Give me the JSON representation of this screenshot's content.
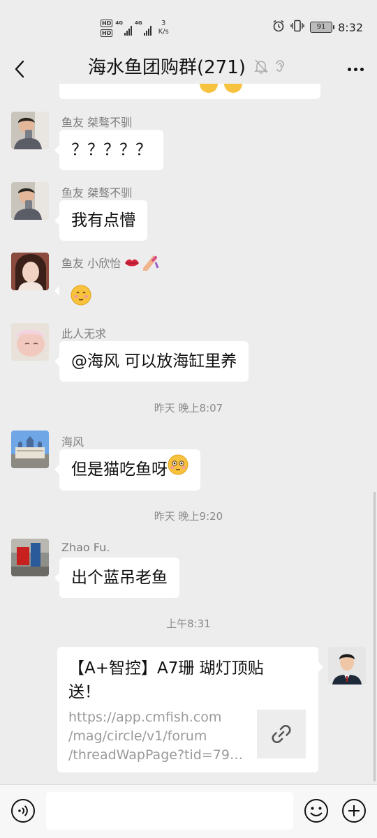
{
  "status_bar": {
    "hd_badge_1": "HD",
    "hd_badge_2": "HD",
    "network_1": "4G",
    "network_2": "4G",
    "speed_value": "3",
    "speed_unit": "K/s",
    "battery": "91",
    "time": "8:32"
  },
  "header": {
    "title": "海水鱼团购群(271)"
  },
  "messages": [
    {
      "sender": "鱼友 桀骜不驯",
      "text": "？？？？？"
    },
    {
      "sender": "鱼友 桀骜不驯",
      "text": "我有点懵"
    },
    {
      "sender": "鱼友 小欣怡",
      "text": ""
    },
    {
      "sender": "此人无求",
      "text": "@海风  可以放海缸里养"
    },
    {
      "sender": "海风",
      "text": "但是猫吃鱼呀"
    },
    {
      "sender": "Zhao Fu.",
      "text": "出个蓝吊老鱼"
    }
  ],
  "timestamps": [
    "昨天 晚上8:07",
    "昨天 晚上9:20",
    "上午8:31"
  ],
  "link_card": {
    "title": "【A+智控】A7珊 瑚灯顶贴送！",
    "url_line1": "https://app.cmfish.com",
    "url_line2": "/mag/circle/v1/forum",
    "url_line3": "/threadWapPage?tid=799..."
  },
  "input_bar": {
    "placeholder": ""
  },
  "colors": {
    "background": "#ededed",
    "bubble": "#ffffff",
    "sender_text": "#7d7d7d"
  }
}
